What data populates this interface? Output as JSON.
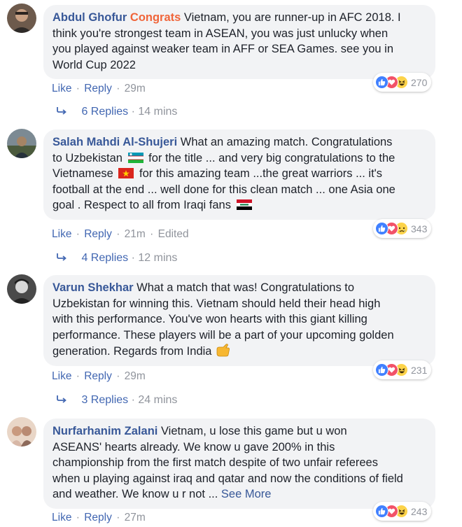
{
  "comments": [
    {
      "author": "Abdul Ghofur",
      "accent": "Congrats",
      "text": "Vietnam, you are runner-up in AFC 2018. I think you're strongest team in ASEAN, you was just unlucky when you played against weaker team in AFF or SEA Games. see you in World Cup 2022",
      "line1_rest": "Vietnam, you are runner-up in AFC 2018. I",
      "line2": "think you're strongest team in ASEAN, you was just unlucky when",
      "line3": "you played against weaker team in AFF or SEA Games. see you in",
      "line4": "World Cup 2022",
      "like_label": "Like",
      "reply_label": "Reply",
      "time": "29m",
      "reaction_count": "270",
      "replies_label": "6 Replies",
      "replies_time": "14 mins"
    },
    {
      "author": "Salah Mahdi Al-Shujeri",
      "line1_rest": "What an amazing match. Congratulations",
      "line2_a": "to Uzbekistan",
      "line2_b": "for the title ... and very big congratulations to the",
      "line3_a": "Vietnamese",
      "line3_b": "for this amazing team ...the great warriors ... it's",
      "line4": "football at the end ... well done for this clean match ... one Asia one",
      "line5": "goal . Respect to all from Iraqi fans",
      "like_label": "Like",
      "reply_label": "Reply",
      "time": "21m",
      "edited": "Edited",
      "reaction_count": "343",
      "replies_label": "4 Replies",
      "replies_time": "12 mins"
    },
    {
      "author": "Varun Shekhar",
      "line1_rest": "What a match that was! Congratulations to",
      "line2": "Uzbekistan for winning this. Vietnam should held their head high",
      "line3": "with this performance. You've won hearts with this giant killing",
      "line4": "performance. These players will be a part of your upcoming golden",
      "line5": "generation. Regards from India",
      "like_label": "Like",
      "reply_label": "Reply",
      "time": "29m",
      "reaction_count": "231",
      "replies_label": "3 Replies",
      "replies_time": "24 mins"
    },
    {
      "author": "Nurfarhanim Zalani",
      "line1_rest": "Vietnam, u lose this game but u won",
      "line2": "ASEANS' hearts already. We know u gave 200% in this",
      "line3": "championship from the first match despite of two unfair referees",
      "line4": "when u playing against iraq and qatar and now the conditions of field",
      "line5": "and weather. We know u r not ...",
      "see_more": "See More",
      "like_label": "Like",
      "reply_label": "Reply",
      "time": "27m",
      "reaction_count": "243"
    }
  ],
  "colors": {
    "author": "#385898",
    "accent": "#f0653a",
    "link": "#4267b2",
    "meta": "#90949c",
    "bubble": "#f2f3f5"
  }
}
